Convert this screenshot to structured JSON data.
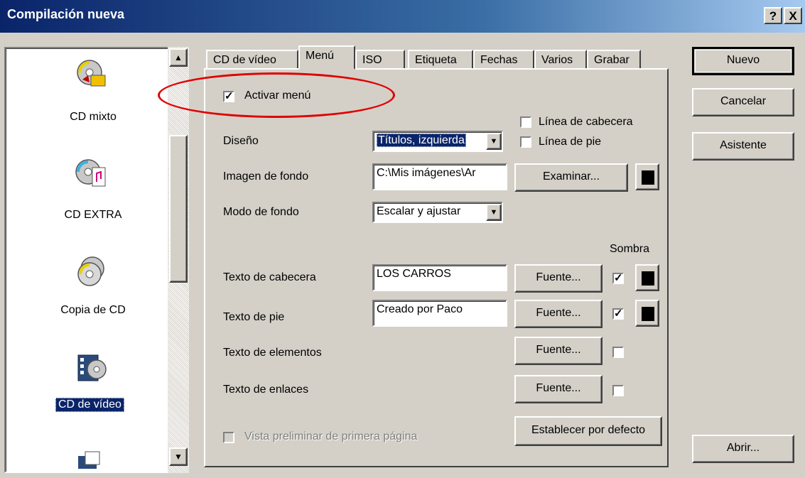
{
  "window": {
    "title": "Compilación nueva",
    "help_btn": "?",
    "close_btn": "X"
  },
  "list": {
    "items": [
      {
        "label": "CD mixto",
        "icon": "cd-mixed-icon"
      },
      {
        "label": "CD EXTRA",
        "icon": "cd-extra-icon"
      },
      {
        "label": "Copia de CD",
        "icon": "cd-copy-icon"
      },
      {
        "label": "CD de vídeo",
        "icon": "video-cd-icon",
        "selected": true
      }
    ]
  },
  "tabs": [
    {
      "label": "CD de vídeo"
    },
    {
      "label": "Menú",
      "active": true
    },
    {
      "label": "ISO"
    },
    {
      "label": "Etiqueta"
    },
    {
      "label": "Fechas"
    },
    {
      "label": "Varios"
    },
    {
      "label": "Grabar"
    }
  ],
  "menu": {
    "activar": {
      "label": "Activar menú",
      "checked": true
    },
    "linea_cabecera": {
      "label": "Línea de cabecera",
      "checked": false
    },
    "linea_pie": {
      "label": "Línea de pie",
      "checked": false
    },
    "diseno": {
      "label": "Diseño",
      "value": "Títulos, izquierda"
    },
    "imagen": {
      "label": "Imagen de fondo",
      "value": "C:\\Mis imágenes\\Ar",
      "button": "Examinar..."
    },
    "modo": {
      "label": "Modo de fondo",
      "value": "Escalar y ajustar"
    },
    "sombra": "Sombra",
    "texto_cabecera": {
      "label": "Texto de cabecera",
      "value": "LOS CARROS",
      "button": "Fuente...",
      "shadow": true
    },
    "texto_pie": {
      "label": "Texto de pie",
      "value": "Creado por Paco",
      "button": "Fuente...",
      "shadow": true
    },
    "texto_elementos": {
      "label": "Texto de elementos",
      "button": "Fuente...",
      "shadow": false
    },
    "texto_enlaces": {
      "label": "Texto de enlaces",
      "button": "Fuente...",
      "shadow": false
    },
    "vista_previa": {
      "label": "Vista preliminar de primera página",
      "enabled": false
    },
    "defecto_button": "Establecer por defecto"
  },
  "buttons": {
    "nuevo": "Nuevo",
    "cancelar": "Cancelar",
    "asistente": "Asistente",
    "abrir": "Abrir..."
  },
  "colors": {
    "title_start": "#0a246a",
    "title_end": "#a6caf0",
    "highlight_oval": "#e00000",
    "selection": "#0a246a"
  }
}
